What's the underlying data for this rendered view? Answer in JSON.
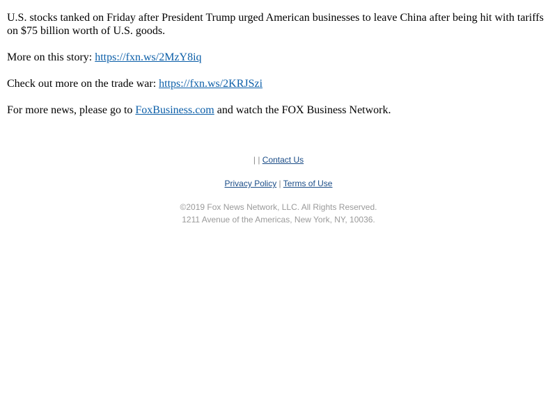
{
  "article": {
    "summary": "U.S. stocks tanked on Friday after President Trump urged American businesses to leave China after being hit with tariffs on $75 billion worth of U.S. goods.",
    "more_story_label": "More on this story: ",
    "more_story_link": "https://fxn.ws/2MzY8iq",
    "trade_war_label": "Check out more on the trade war: ",
    "trade_war_link": "https://fxn.ws/2KRJSzi",
    "more_news_prefix": "For more news, please go to ",
    "more_news_link": "FoxBusiness.com",
    "more_news_suffix": " and watch the FOX Business Network."
  },
  "footer": {
    "separator": "|",
    "contact_us": "Contact Us",
    "privacy_policy": "Privacy Policy",
    "terms_of_use": "Terms of Use",
    "copyright": "©2019 Fox News Network, LLC. All Rights Reserved.",
    "address": "1211 Avenue of the Americas, New York, NY, 10036."
  },
  "colors": {
    "link": "#0b5ea8",
    "footer_link": "#1a4c87",
    "footer_muted": "#9a9a9a"
  }
}
